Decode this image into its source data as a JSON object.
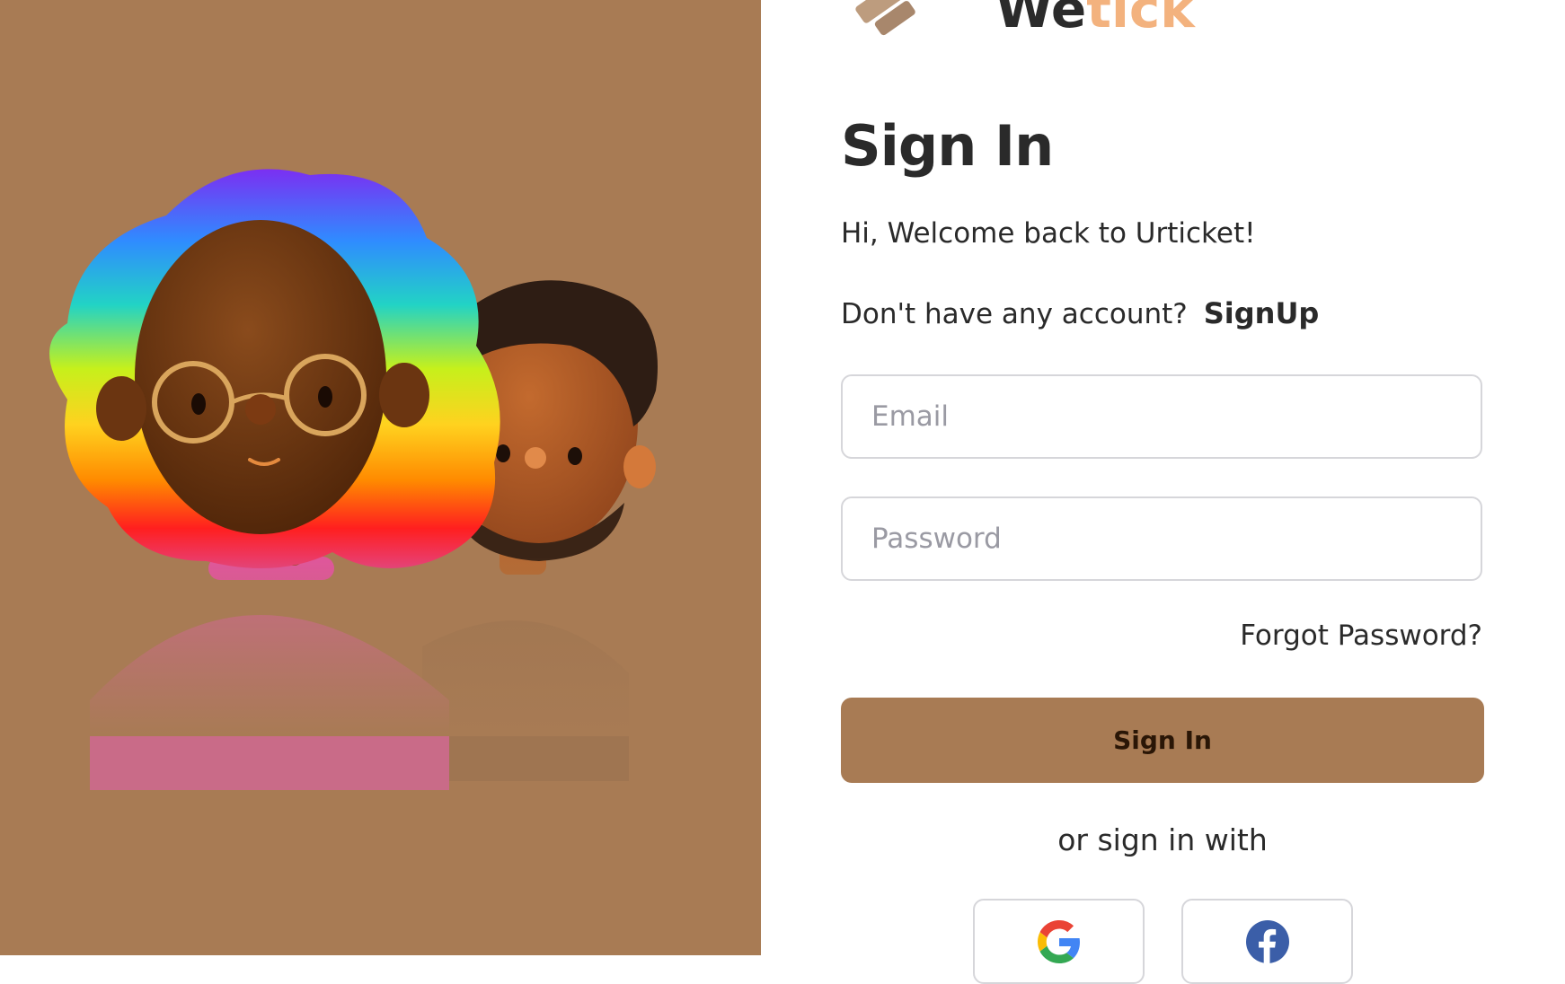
{
  "brand": {
    "name_part1": "We",
    "name_part2": "tick",
    "mark_icon": "ticket-logo-icon",
    "colors": {
      "dark": "#2b2b2b",
      "accent": "#f3b27e"
    }
  },
  "hero": {
    "background": "#a87b54",
    "illustration": "two-3d-avatars-illustration"
  },
  "form": {
    "title": "Sign In",
    "welcome": "Hi, Welcome back to Urticket!",
    "no_account_text": "Don't have any account?",
    "signup_label": "SignUp",
    "email_placeholder": "Email",
    "email_value": "",
    "password_placeholder": "Password",
    "password_value": "",
    "forgot_label": "Forgot Password?",
    "submit_label": "Sign In",
    "alt_text": "or sign in with"
  },
  "social": {
    "providers": [
      {
        "id": "google",
        "icon": "google-icon"
      },
      {
        "id": "facebook",
        "icon": "facebook-icon"
      }
    ]
  },
  "theme": {
    "primary": "#a87b54",
    "text": "#2a2a2a",
    "border": "#d6d6da",
    "placeholder": "#9a9aa3"
  }
}
